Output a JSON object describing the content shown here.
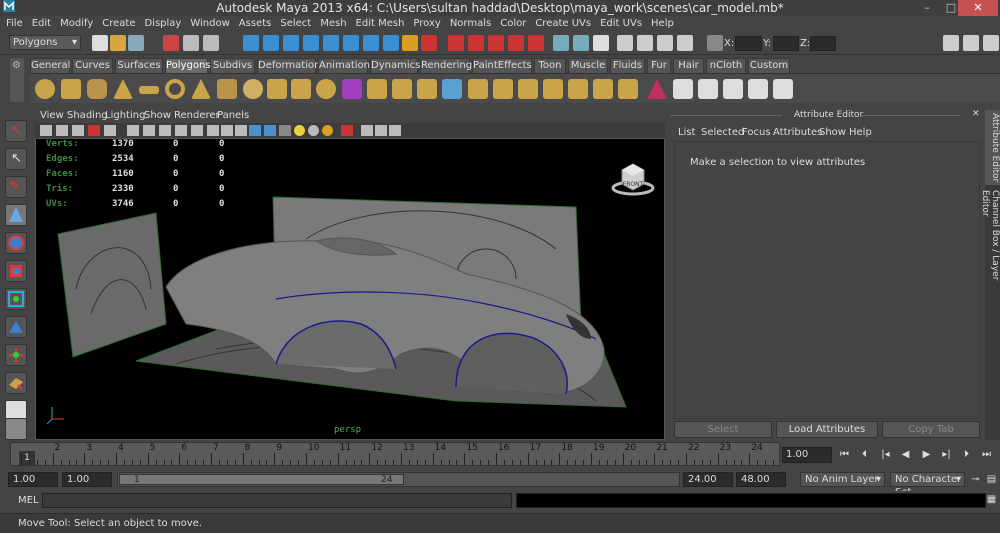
{
  "window": {
    "title": "Autodesk Maya 2013 x64: C:\\Users\\sultan haddad\\Desktop\\maya_work\\scenes\\car_model.mb*",
    "minimize": "–",
    "maximize": "□",
    "close": "✕"
  },
  "menubar": [
    "File",
    "Edit",
    "Modify",
    "Create",
    "Display",
    "Window",
    "Assets",
    "Select",
    "Mesh",
    "Edit Mesh",
    "Proxy",
    "Normals",
    "Color",
    "Create UVs",
    "Edit UVs",
    "Help"
  ],
  "statusline": {
    "mode": "Polygons",
    "x_label": "X:",
    "y_label": "Y:",
    "z_label": "Z:"
  },
  "shelf": {
    "tabs": [
      "General",
      "Curves",
      "Surfaces",
      "Polygons",
      "Subdivs",
      "Deformation",
      "Animation",
      "Dynamics",
      "Rendering",
      "PaintEffects",
      "Toon",
      "Muscle",
      "Fluids",
      "Fur",
      "Hair",
      "nCloth",
      "Custom"
    ],
    "active": "Polygons"
  },
  "panel": {
    "menu": [
      "View",
      "Shading",
      "Lighting",
      "Show",
      "Renderer",
      "Panels"
    ],
    "camera": "persp",
    "viewcube_label": "FRONT"
  },
  "hud": [
    {
      "label": "Verts:",
      "v1": "1370",
      "v2": "0",
      "v3": "0"
    },
    {
      "label": "Edges:",
      "v1": "2534",
      "v2": "0",
      "v3": "0"
    },
    {
      "label": "Faces:",
      "v1": "1160",
      "v2": "0",
      "v3": "0"
    },
    {
      "label": "Tris:",
      "v1": "2330",
      "v2": "0",
      "v3": "0"
    },
    {
      "label": "UVs:",
      "v1": "3746",
      "v2": "0",
      "v3": "0"
    }
  ],
  "attribute_editor": {
    "title": "Attribute Editor",
    "menu": [
      "List",
      "Selected",
      "Focus",
      "Attributes",
      "Show",
      "Help"
    ],
    "message": "Make a selection to view attributes",
    "buttons": [
      "Select",
      "Load Attributes",
      "Copy Tab"
    ],
    "side_tabs": [
      "Attribute Editor",
      "Channel Box / Layer Editor"
    ]
  },
  "timeline": {
    "ticks": [
      "1",
      "2",
      "3",
      "4",
      "5",
      "6",
      "7",
      "8",
      "9",
      "10",
      "11",
      "12",
      "13",
      "14",
      "15",
      "16",
      "17",
      "18",
      "19",
      "20",
      "21",
      "22",
      "23",
      "24"
    ],
    "current_frame": "1",
    "current_time": "1.00"
  },
  "range": {
    "start": "1.00",
    "playback_start": "1.00",
    "handle_start": "1",
    "handle_end": "24",
    "playback_end": "24.00",
    "end": "48.00",
    "anim_layer": "No Anim Layer",
    "character_set": "No Character Set"
  },
  "command": {
    "label": "MEL"
  },
  "help": {
    "text": "Move Tool: Select an object to move."
  }
}
